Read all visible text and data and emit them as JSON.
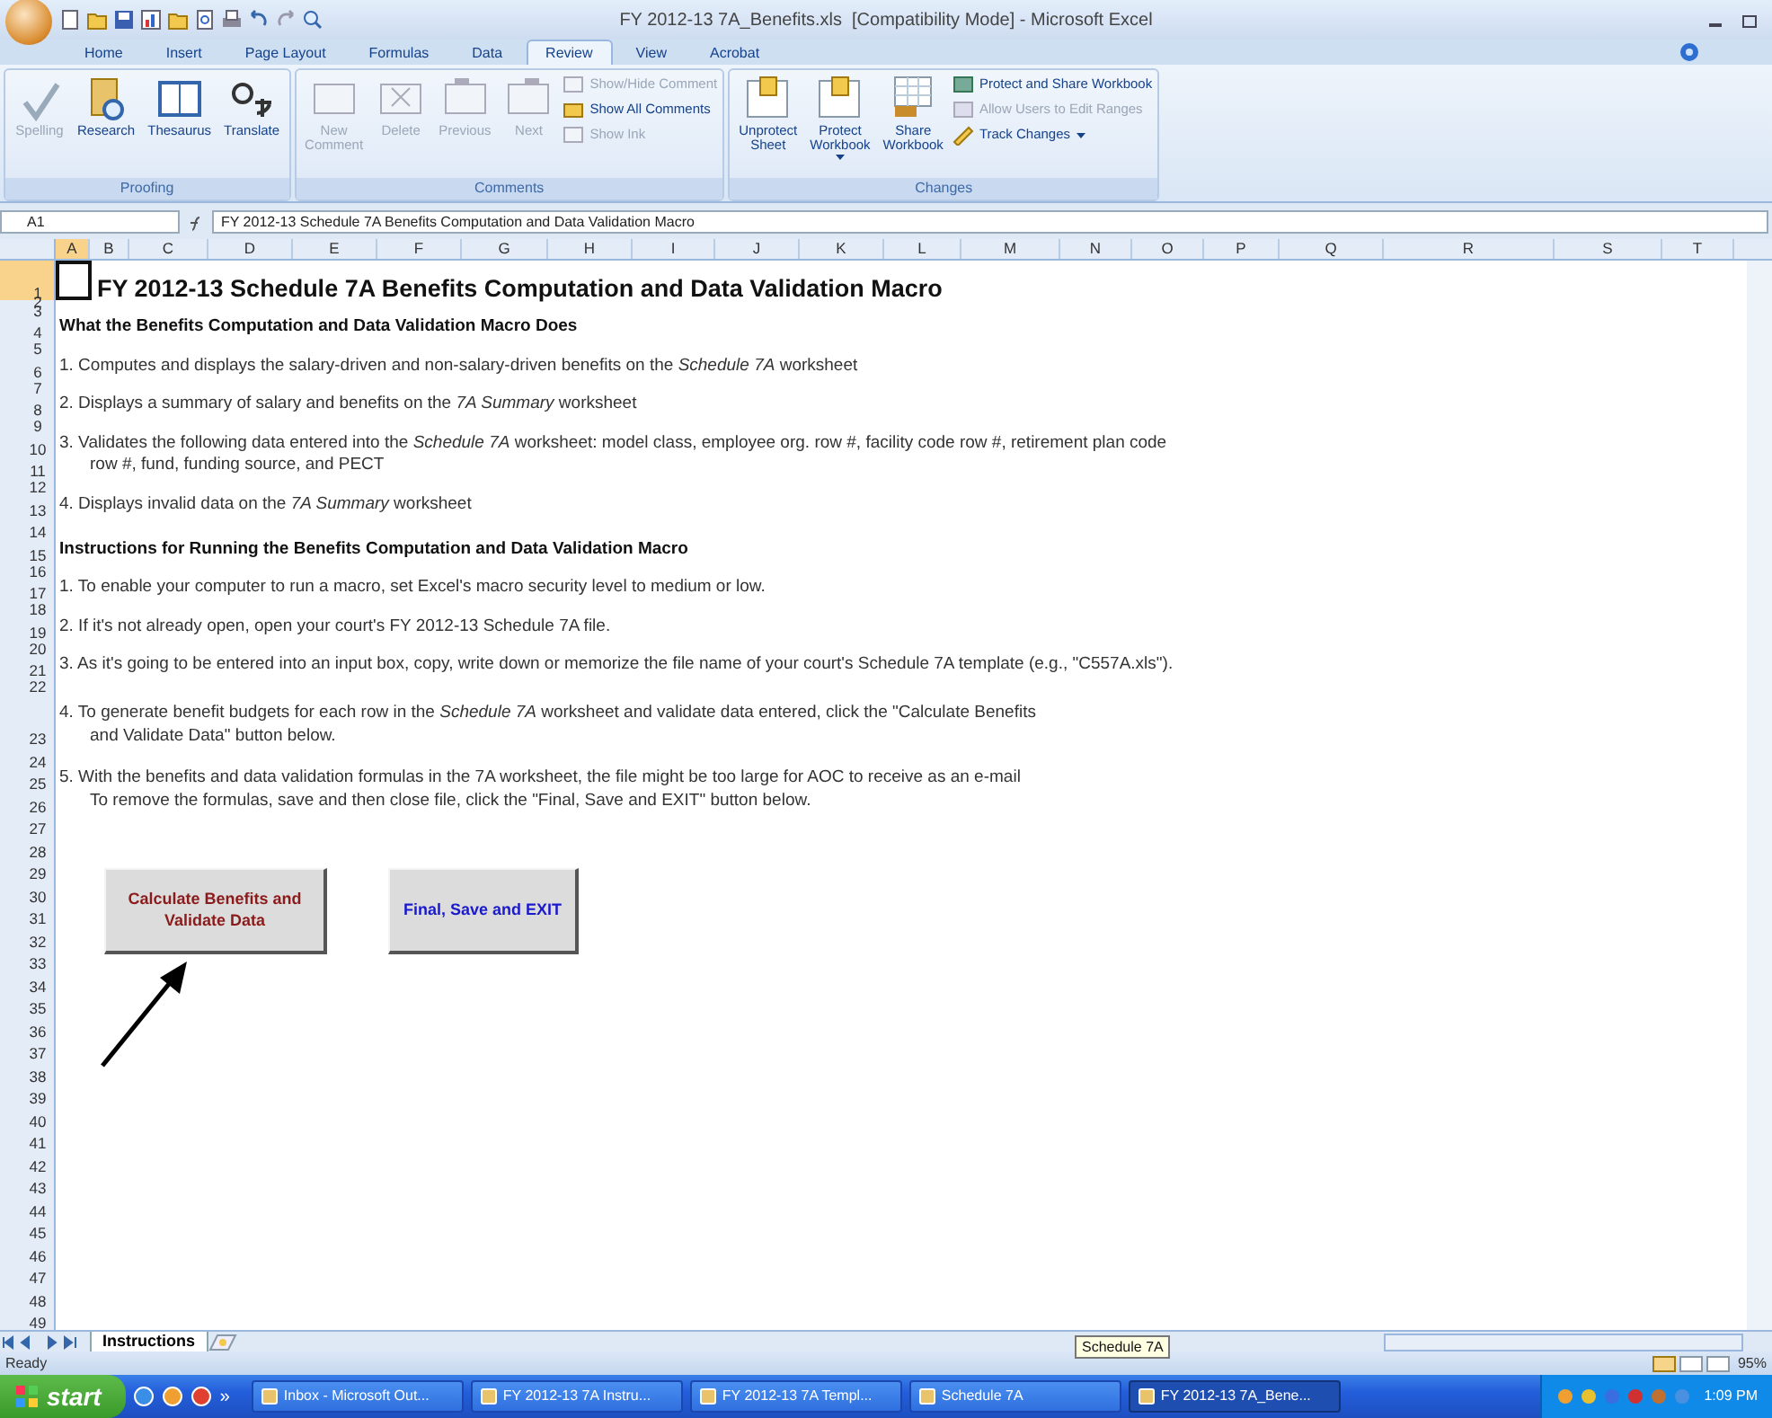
{
  "window": {
    "title": "FY 2012-13 7A_Benefits.xls  [Compatibility Mode] - Microsoft Excel"
  },
  "ribbon_tabs": [
    {
      "label": "Home",
      "selected": false
    },
    {
      "label": "Insert",
      "selected": false
    },
    {
      "label": "Page Layout",
      "selected": false
    },
    {
      "label": "Formulas",
      "selected": false
    },
    {
      "label": "Data",
      "selected": false
    },
    {
      "label": "Review",
      "selected": true
    },
    {
      "label": "View",
      "selected": false
    },
    {
      "label": "Acrobat",
      "selected": false
    }
  ],
  "ribbon_groups": [
    {
      "label": "Proofing",
      "buttons": [
        {
          "label": "Spelling",
          "kind": "large",
          "disabled": true
        },
        {
          "label": "Research",
          "kind": "large",
          "disabled": false
        },
        {
          "label": "Thesaurus",
          "kind": "large",
          "disabled": false
        },
        {
          "label": "Translate",
          "kind": "large",
          "disabled": false
        }
      ]
    },
    {
      "label": "Comments",
      "buttons": [
        {
          "label": "New\nComment",
          "kind": "large",
          "disabled": true
        },
        {
          "label": "Delete",
          "kind": "large",
          "disabled": true
        },
        {
          "label": "Previous",
          "kind": "large",
          "disabled": true
        },
        {
          "label": "Next",
          "kind": "large",
          "disabled": true
        },
        {
          "label": "Show/Hide Comment",
          "kind": "small",
          "disabled": true
        },
        {
          "label": "Show All Comments",
          "kind": "small",
          "disabled": false
        },
        {
          "label": "Show Ink",
          "kind": "small",
          "disabled": true
        }
      ]
    },
    {
      "label": "Changes",
      "buttons": [
        {
          "label": "Unprotect\nSheet",
          "kind": "large",
          "disabled": false
        },
        {
          "label": "Protect\nWorkbook",
          "kind": "large",
          "disabled": false,
          "dropdown": true
        },
        {
          "label": "Share\nWorkbook",
          "kind": "large",
          "disabled": false
        },
        {
          "label": "Protect and Share Workbook",
          "kind": "small",
          "disabled": false
        },
        {
          "label": "Allow Users to Edit Ranges",
          "kind": "small",
          "disabled": true
        },
        {
          "label": "Track Changes",
          "kind": "small",
          "disabled": false,
          "dropdown": true
        }
      ]
    }
  ],
  "formula_bar": {
    "name_box": "A1",
    "formula": "FY 2012-13 Schedule 7A Benefits Computation and Data Validation Macro"
  },
  "columns": [
    {
      "label": "A",
      "selected": true
    },
    {
      "label": "B",
      "selected": false
    },
    {
      "label": "C",
      "selected": false
    },
    {
      "label": "D",
      "selected": false
    },
    {
      "label": "E",
      "selected": false
    },
    {
      "label": "F",
      "selected": false
    },
    {
      "label": "G",
      "selected": false
    },
    {
      "label": "H",
      "selected": false
    },
    {
      "label": "I",
      "selected": false
    },
    {
      "label": "J",
      "selected": false
    },
    {
      "label": "K",
      "selected": false
    },
    {
      "label": "L",
      "selected": false
    },
    {
      "label": "M",
      "selected": false
    },
    {
      "label": "N",
      "selected": false
    },
    {
      "label": "O",
      "selected": false
    },
    {
      "label": "P",
      "selected": false
    },
    {
      "label": "Q",
      "selected": false
    },
    {
      "label": "R",
      "selected": false
    },
    {
      "label": "S",
      "selected": false
    },
    {
      "label": "T",
      "selected": false
    }
  ],
  "rows": [
    {
      "number": "1",
      "kind": "title",
      "selected": true,
      "text": "FY 2012-13 Schedule 7A Benefits Computation and Data Validation Macro"
    },
    {
      "number": "2",
      "kind": "tiny",
      "selected": false
    },
    {
      "number": "3",
      "kind": "tiny",
      "selected": false
    },
    {
      "number": "4",
      "kind": "heading",
      "selected": false,
      "text": "What the Benefits Computation and Data Validation Macro Does"
    },
    {
      "number": "5",
      "kind": "thin",
      "selected": false
    },
    {
      "number": "6",
      "kind": "item",
      "selected": false,
      "text": "1. Computes and displays the salary-driven and non-salary-driven benefits on the *Schedule 7A* worksheet"
    },
    {
      "number": "7",
      "kind": "thin",
      "selected": false
    },
    {
      "number": "8",
      "kind": "item",
      "selected": false,
      "text": "2. Displays a summary of salary and benefits on the *7A Summary* worksheet"
    },
    {
      "number": "9",
      "kind": "thin",
      "selected": false
    },
    {
      "number": "10",
      "kind": "item",
      "selected": false,
      "text": "3. Validates the following data entered into the *Schedule 7A* worksheet:  model class, employee org. row #, facility code row #, retirement plan code"
    },
    {
      "number": "11",
      "kind": "continuation",
      "selected": false,
      "text": "row #, fund, funding source, and PECT"
    },
    {
      "number": "12",
      "kind": "thin",
      "selected": false
    },
    {
      "number": "13",
      "kind": "item",
      "selected": false,
      "text": "4. Displays invalid data on the *7A Summary* worksheet"
    },
    {
      "number": "14",
      "kind": "blank",
      "selected": false
    },
    {
      "number": "15",
      "kind": "heading",
      "selected": false,
      "text": "Instructions for Running the Benefits Computation and Data Validation Macro"
    },
    {
      "number": "16",
      "kind": "thin",
      "selected": false
    },
    {
      "number": "17",
      "kind": "item",
      "selected": false,
      "text": "1. To enable your computer to run a macro, set Excel's macro security level to medium or low."
    },
    {
      "number": "18",
      "kind": "thin",
      "selected": false
    },
    {
      "number": "19",
      "kind": "item",
      "selected": false,
      "text": "2. If it's not already open, open your court's FY 2012-13 Schedule 7A file."
    },
    {
      "number": "20",
      "kind": "thin",
      "selected": false
    },
    {
      "number": "21",
      "kind": "item",
      "selected": false,
      "text": "3. As it's going to be entered into an input box, copy, write down or memorize the file name of your court's Schedule 7A template (e.g., \"C557A.xls\")."
    },
    {
      "number": "22",
      "kind": "thin",
      "selected": false
    },
    {
      "number": "23",
      "kind": "wrapped",
      "selected": false,
      "lines": [
        "4. To generate benefit budgets for each row in the *Schedule 7A* worksheet and validate data entered, click the \"Calculate Benefits",
        "and Validate Data\" button below."
      ]
    },
    {
      "number": "24",
      "kind": "blank",
      "selected": false
    },
    {
      "number": "25",
      "kind": "item",
      "selected": false,
      "text": "5.  With the benefits and data validation formulas in the 7A worksheet, the file might be too large for AOC to receive as an e-mail"
    },
    {
      "number": "26",
      "kind": "continuation",
      "selected": false,
      "text": "To remove the formulas, save and then close file, click the \"Final, Save and EXIT\" button below."
    },
    {
      "number": "27",
      "kind": "blank",
      "selected": false
    },
    {
      "number": "28",
      "kind": "blank",
      "selected": false
    },
    {
      "number": "29",
      "kind": "blank",
      "selected": false
    },
    {
      "number": "30",
      "kind": "blank",
      "selected": false
    },
    {
      "number": "31",
      "kind": "blank",
      "selected": false
    },
    {
      "number": "32",
      "kind": "blank",
      "selected": false
    },
    {
      "number": "33",
      "kind": "blank",
      "selected": false
    },
    {
      "number": "34",
      "kind": "blank",
      "selected": false
    },
    {
      "number": "35",
      "kind": "blank",
      "selected": false
    },
    {
      "number": "36",
      "kind": "blank",
      "selected": false
    },
    {
      "number": "37",
      "kind": "blank",
      "selected": false
    },
    {
      "number": "38",
      "kind": "blank",
      "selected": false
    },
    {
      "number": "39",
      "kind": "blank",
      "selected": false
    },
    {
      "number": "40",
      "kind": "blank",
      "selected": false
    },
    {
      "number": "41",
      "kind": "blank",
      "selected": false
    },
    {
      "number": "42",
      "kind": "blank",
      "selected": false
    },
    {
      "number": "43",
      "kind": "blank",
      "selected": false
    },
    {
      "number": "44",
      "kind": "blank",
      "selected": false
    },
    {
      "number": "45",
      "kind": "blank",
      "selected": false
    },
    {
      "number": "46",
      "kind": "blank",
      "selected": false
    },
    {
      "number": "47",
      "kind": "blank",
      "selected": false
    },
    {
      "number": "48",
      "kind": "blank",
      "selected": false
    },
    {
      "number": "49",
      "kind": "blank",
      "selected": false
    }
  ],
  "macro_buttons": [
    {
      "label": "Calculate Benefits and Validate Data",
      "color": "#8b1a1a"
    },
    {
      "label": "Final, Save and EXIT",
      "color": "#1a1acc"
    }
  ],
  "sheet_tabs": [
    {
      "label": "Instructions",
      "selected": true
    }
  ],
  "status_bar": {
    "text": "Ready",
    "tooltip": "Schedule 7A",
    "zoom": "95%"
  },
  "taskbar": {
    "start": "start",
    "more": "»",
    "items": [
      {
        "label": "Inbox - Microsoft Out...",
        "selected": false
      },
      {
        "label": "FY 2012-13 7A Instru...",
        "selected": false
      },
      {
        "label": "FY 2012-13 7A Templ...",
        "selected": false
      },
      {
        "label": "Schedule 7A",
        "selected": false
      },
      {
        "label": "FY 2012-13 7A_Bene...",
        "selected": true
      }
    ],
    "clock": "1:09 PM"
  }
}
